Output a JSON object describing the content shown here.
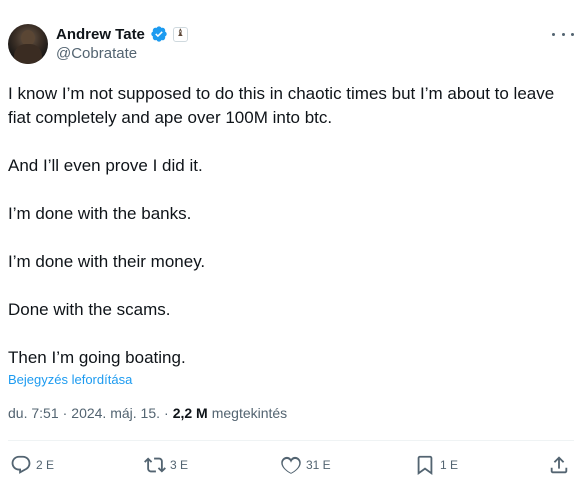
{
  "author": {
    "display_name": "Andrew Tate",
    "handle": "@Cobratate",
    "verified": true,
    "affiliate_badge_icon": "chess-piece-icon"
  },
  "tweet": {
    "paragraphs": [
      "I know I’m not supposed to do this in chaotic times but I’m about to leave fiat completely and ape over 100M into btc.",
      "And I’ll even prove I did it.",
      "I’m done with the banks.",
      "I’m done with their money.",
      "Done with the scams.",
      "Then I’m going boating."
    ],
    "translate_label": "Bejegyzés lefordítása"
  },
  "meta": {
    "time": "du. 7:51",
    "sep1": "·",
    "date": "2024. máj. 15.",
    "sep2": "·",
    "views_count": "2,2 M",
    "views_label": "megtekintés"
  },
  "actions": {
    "replies": "2 E",
    "reposts": "3 E",
    "likes": "31 E",
    "bookmarks": "1 E"
  },
  "colors": {
    "text": "#0f1419",
    "secondary": "#536471",
    "link": "#1d9bf0",
    "divider": "#eff3f4"
  }
}
